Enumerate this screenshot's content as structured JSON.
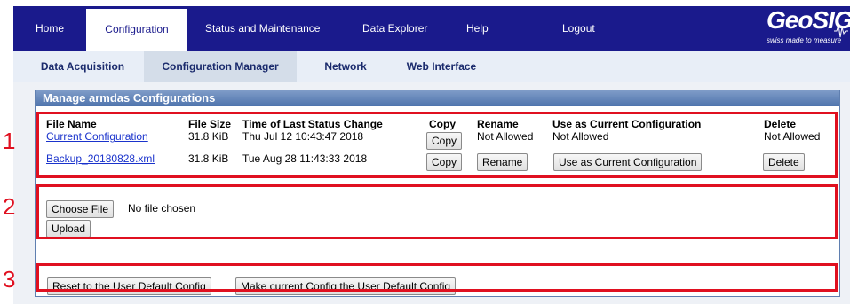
{
  "topnav": {
    "items": [
      {
        "label": "Home"
      },
      {
        "label": "Configuration"
      },
      {
        "label": "Status and Maintenance"
      },
      {
        "label": "Data Explorer"
      },
      {
        "label": "Help"
      },
      {
        "label": "Logout"
      }
    ],
    "active_index": 1,
    "logo": {
      "brand": "GeoSIG",
      "tagline": "swiss made to measure"
    }
  },
  "subnav": {
    "items": [
      {
        "label": "Data Acquisition"
      },
      {
        "label": "Configuration Manager"
      },
      {
        "label": "Network"
      },
      {
        "label": "Web Interface"
      }
    ],
    "active_index": 1
  },
  "panel": {
    "title": "Manage armdas Configurations",
    "headers": {
      "file_name": "File Name",
      "file_size": "File Size",
      "time": "Time of Last Status Change",
      "copy": "Copy",
      "rename": "Rename",
      "use": "Use as Current Configuration",
      "delete": "Delete"
    },
    "rows": [
      {
        "file_name": "Current Configuration",
        "file_size": "31.8 KiB",
        "time": "Thu Jul 12 10:43:47 2018",
        "copy": "Copy",
        "rename": "Not Allowed",
        "use": "Not Allowed",
        "delete": "Not Allowed"
      },
      {
        "file_name": "Backup_20180828.xml",
        "file_size": "31.8 KiB",
        "time": "Tue Aug 28 11:43:33 2018",
        "copy": "Copy",
        "rename": "Rename",
        "use": "Use as Current Configuration",
        "delete": "Delete"
      }
    ],
    "upload": {
      "choose_label": "Choose File",
      "no_file_text": "No file chosen",
      "upload_label": "Upload"
    },
    "defaults": {
      "reset_label": "Reset to the User Default Config",
      "make_label": "Make current Config the User Default Config"
    }
  },
  "annotations": {
    "m1": "1",
    "m2": "2",
    "m3": "3"
  },
  "colors": {
    "nav_bg": "#1a1a8c",
    "highlight": "#e01020",
    "link": "#1a33cc"
  }
}
